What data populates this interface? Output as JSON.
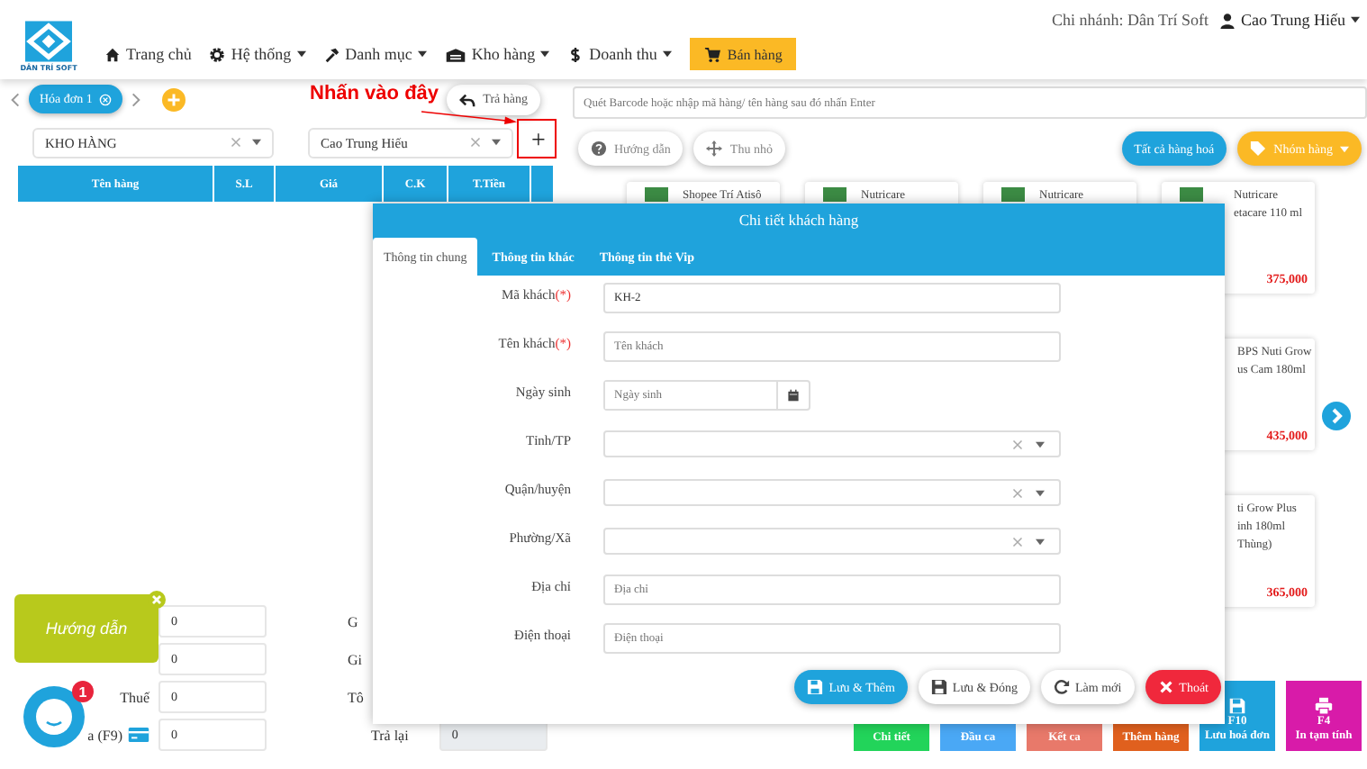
{
  "header": {
    "logo_text": "DÂN TRÍ SOFT",
    "nav": [
      {
        "label": "Trang chủ",
        "kind": "home",
        "dropdown": false
      },
      {
        "label": "Hệ thống",
        "kind": "gear",
        "dropdown": true
      },
      {
        "label": "Danh mục",
        "kind": "hammer",
        "dropdown": true
      },
      {
        "label": "Kho hàng",
        "kind": "warehouse",
        "dropdown": true
      },
      {
        "label": "Doanh thu",
        "kind": "dollar",
        "dropdown": true
      }
    ],
    "sell_button": "Bán hàng",
    "branch": "Chi nhánh: Dân Trí Soft",
    "user": "Cao Trung Hiếu"
  },
  "invoice_tabs": [
    {
      "label": "Hóa đơn 1",
      "selected": true
    }
  ],
  "return_button": "Trả hàng",
  "annotation": "Nhấn vào đây",
  "warehouse_select": "KHO HÀNG",
  "staff_select": "Cao Trung Hiếu",
  "add_customer_button": "+",
  "cart_table": {
    "columns": [
      "Tên hàng",
      "S.L",
      "Giá",
      "C.K",
      "T.Tiền"
    ]
  },
  "summary": [
    {
      "kind": "plain",
      "value": "0",
      "right_label": "G"
    },
    {
      "kind": "plain",
      "value": "0",
      "right_label": "Gi"
    },
    {
      "kind": "plain",
      "label": "Thuế",
      "value": "0",
      "right_label": "Tô"
    },
    {
      "kind": "card",
      "label": "a (F9)",
      "value": "0",
      "right_label": "Trả lại",
      "right_value": "0"
    }
  ],
  "search": {
    "placeholder": "Quét Barcode hoặc nhập mã hàng/ tên hàng sau đó nhấn Enter"
  },
  "tool_buttons": [
    {
      "label": "Hướng dẫn",
      "kind": "help"
    },
    {
      "label": "Thu nhỏ",
      "kind": "shrink"
    }
  ],
  "all_products_button": "Tất cả hàng hoá",
  "group_button": "Nhóm hàng",
  "products": [
    {
      "image": true,
      "lines": [
        "Shopee Trí Atisô"
      ]
    },
    {
      "image": true,
      "lines": [
        "Nutricare"
      ]
    },
    {
      "image": true,
      "lines": [
        "Nutricare"
      ]
    },
    {
      "image": true,
      "lines": [
        "Nutricare",
        "etacare 110 ml"
      ],
      "price": "375,000"
    },
    {
      "image": false,
      "lines": [
        "BPS Nuti Grow",
        "us Cam 180ml"
      ],
      "price": "435,000"
    },
    {
      "image": false,
      "lines": [
        "ti Grow Plus",
        "inh 180ml",
        "Thùng)"
      ],
      "price": "365,000"
    }
  ],
  "bottom_actions": [
    {
      "label": "Chi tiết",
      "color": "#22d45a"
    },
    {
      "label": "Đầu ca",
      "color": "#4aa8f5"
    },
    {
      "label": "Kết ca",
      "color": "#e8796a"
    },
    {
      "label": "Thêm hàng",
      "color": "#e0601e"
    }
  ],
  "function_keys": [
    {
      "key": "F10",
      "label": "Lưu hoá đơn",
      "kind": "save",
      "color": "#1fa3dc"
    },
    {
      "key": "F4",
      "label": "In tạm tính",
      "kind": "print",
      "color": "#d81ba9"
    }
  ],
  "modal": {
    "title": "Chi tiết khách hàng",
    "tabs": [
      {
        "label": "Thông tin chung",
        "selected": true
      },
      {
        "label": "Thông tin khác",
        "selected": false
      },
      {
        "label": "Thông tin thẻ Vip",
        "selected": false
      }
    ],
    "fields": [
      {
        "kind": "text",
        "label": "Mã khách",
        "mark": "(*)",
        "value": "KH-2"
      },
      {
        "kind": "text",
        "label": "Tên khách",
        "mark": "(*)",
        "placeholder": "Tên khách"
      },
      {
        "kind": "date",
        "label": "Ngày sinh",
        "placeholder": "Ngày sinh"
      },
      {
        "kind": "select",
        "label": "Tỉnh/TP"
      },
      {
        "kind": "select",
        "label": "Quận/huyện"
      },
      {
        "kind": "select",
        "label": "Phường/Xã"
      },
      {
        "kind": "text",
        "label": "Địa chỉ",
        "placeholder": "Địa chỉ"
      },
      {
        "kind": "text",
        "label": "Điện thoại",
        "placeholder": "Điện thoại"
      }
    ],
    "buttons": [
      {
        "label": "Lưu & Thêm",
        "kind": "save_add"
      },
      {
        "label": "Lưu & Đóng",
        "kind": "save_close"
      },
      {
        "label": "Làm mới",
        "kind": "refresh"
      },
      {
        "label": "Thoát",
        "kind": "exit"
      }
    ]
  },
  "chat": {
    "tip": "Hướng dẫn",
    "badge": "1"
  }
}
